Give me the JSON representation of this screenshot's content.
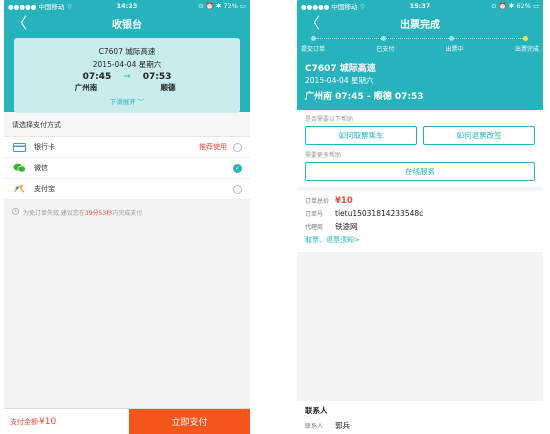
{
  "left": {
    "status": {
      "carrier": "●●●●● 中国移动 ⌔",
      "time": "14:23",
      "battery": "⊙ ⏰ ✱ 72% ▭"
    },
    "nav": {
      "title": "收银台",
      "back": "〈"
    },
    "ticket": {
      "train": "C7607 城际高速",
      "date": "2015-04-04 星期六",
      "depart_time": "07:45",
      "arrive_time": "07:53",
      "arrow": "➞",
      "from": "广州南",
      "to": "顺德",
      "expand": "下滑展开 ﹀"
    },
    "payment": {
      "heading": "请选择支付方式",
      "methods": [
        {
          "label": "银行卡",
          "tag": "推荐使用",
          "selected": false
        },
        {
          "label": "微信",
          "tag": "",
          "selected": true
        },
        {
          "label": "支付宝",
          "tag": "",
          "selected": false
        }
      ]
    },
    "notice": {
      "pre": "为免订单失效,建议您在",
      "time": "39分53秒",
      "post": "内完成支付"
    },
    "bottom": {
      "amount_label": "支付金额",
      "amount": "¥10",
      "pay_button": "立即支付"
    }
  },
  "right": {
    "status": {
      "carrier": "●●●●● 中国移动 ⌔",
      "time": "15:37",
      "battery": "⊙ ⏰ ✱ 62% ▭"
    },
    "nav": {
      "title": "出票完成",
      "back": "〈"
    },
    "steps": [
      "提交订单",
      "已支付",
      "出票中",
      "出票完成"
    ],
    "trip": {
      "train": "C7607 城际高速",
      "date": "2015-04-04 星期六",
      "route": "广州南 07:45 - 顺德 07:53"
    },
    "help": {
      "hint1": "是否需要以下帮助",
      "btn_ticket": "如何取票乘车",
      "btn_refund": "如何退票改签",
      "hint2": "需要更多帮助",
      "btn_online": "在线服务"
    },
    "order": {
      "total_label": "订单总价",
      "total": "¥10",
      "no_label": "订单号",
      "no": "tietu15031814233548c",
      "agent_label": "代理商",
      "agent": "铁途网",
      "link": "取票、退票须知>"
    },
    "contact": {
      "heading": "联系人",
      "name_label": "联系人",
      "name": "郭兵"
    }
  },
  "colors": {
    "teal": "#26b3bb",
    "orange": "#f5561c",
    "red": "#ee4a3a"
  }
}
